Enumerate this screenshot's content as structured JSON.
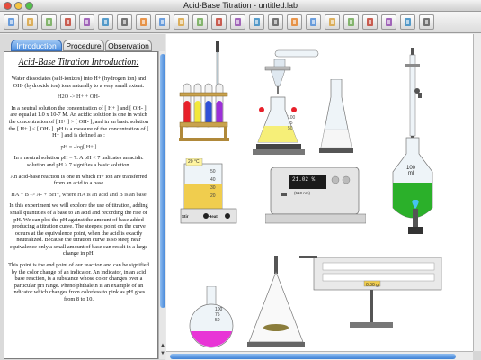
{
  "window": {
    "title": "Acid-Base Titration - untitled.lab"
  },
  "toolbar": {
    "buttons": [
      "new-file-icon",
      "open-folder-icon",
      "save-icon",
      "hand-pointer-icon",
      "beaker-rack-icon",
      "flask-icon",
      "paper-icon",
      "dropper-icon",
      "test-tube-icon",
      "thermometer-icon",
      "scale-icon",
      "meter-icon",
      "burner-icon",
      "tongs-icon",
      "funnel-icon",
      "stir-plate-icon",
      "ph-paper-icon",
      "cylinder-icon",
      "burette-icon",
      "stand-icon",
      "balance-icon",
      "trash-icon",
      "grid-icon"
    ]
  },
  "tabs": [
    {
      "label": "Introduction",
      "active": true
    },
    {
      "label": "Procedure",
      "active": false
    },
    {
      "label": "Observation",
      "active": false
    }
  ],
  "document": {
    "title": "Acid-Base Titration Introduction:",
    "p1": "Water dissociates (self-ionizes) into H+ (hydrogen ion) and OH- (hydroxide ion) ions naturally to a very small extent:",
    "eq1": "H2O   ->   H+   +   OH-",
    "p2": "In a neutral solution the concentration of [ H+ ] and [ OH- ] are equal at 1.0 x 10-7 M. An acidic solution is one in which the concentration of [ H+ ] > [ OH- ], and in an basic solution the [ H+ ] < [ OH- ]. pH is a measure of the concentration of [ H+ ] and is defined as :",
    "eq2": "pH = -log[ H+ ]",
    "p3": "In a neutral solution pH = 7. A pH < 7 indicates an acidic solution and pH > 7 signifies a basic solution.",
    "p4": "An acid-base reaction is one in which H+ ion are transferred from an acid to a base",
    "eq3": "HA   +   B   ->   A-   +   BH+,   where HA is an acid and B is an base",
    "p5": "In this experiment we will explore the use of titration, adding small quantities of a base to an acid and recording the rise of pH. We can plot the pH against the amount of base added producing a titration curve. The steepest point on the curve occurs at the equivalence point, when the acid is exactly neutralized. Because the titration curve is so steep near equivalence only a small amount of base can result in a large change in pH.",
    "p6": "This point is the end point of our reaction and can be signified by the color change of an indicator. An indicator, in an acid base reaction, is a substance whose color changes over a particular pH range. Phenolphthalein is an example of an indicator which changes from colorless to pink as pH goes from 8 to 10."
  },
  "lab": {
    "beaker_labels": {
      "b200": "200",
      "b175": "175",
      "b150": "150",
      "b125": "125"
    },
    "flask_labels": {
      "f100": "100",
      "f75": "75",
      "f50": "50"
    },
    "volumetric_label": "100",
    "volumetric_unit": "ml",
    "hotplate_temp": "20 °C",
    "hotplate_markings": {
      "m50": "50",
      "m40": "40",
      "m30": "30",
      "m20": "20"
    },
    "hotplate_controls": {
      "stir": "Stir",
      "heat": "Heat"
    },
    "spectro_display": "21.02 %",
    "spectro_subdisplay": "(510 nm)",
    "round_flask_labels": {
      "f100": "100",
      "f75": "75",
      "f50": "50",
      "unit": "ml"
    },
    "balance_reading": "0.00 g"
  },
  "colors": {
    "tube_red": "#e8202a",
    "tube_yellow": "#f2e83a",
    "tube_blue": "#2f50d8",
    "tube_purple": "#9c2fd8",
    "erlenmeyer_yellow": "#f6ef78",
    "volumetric_green": "#2bb02a",
    "round_flask_pink": "#e835d6",
    "accent_blue": "#3e81d6"
  }
}
